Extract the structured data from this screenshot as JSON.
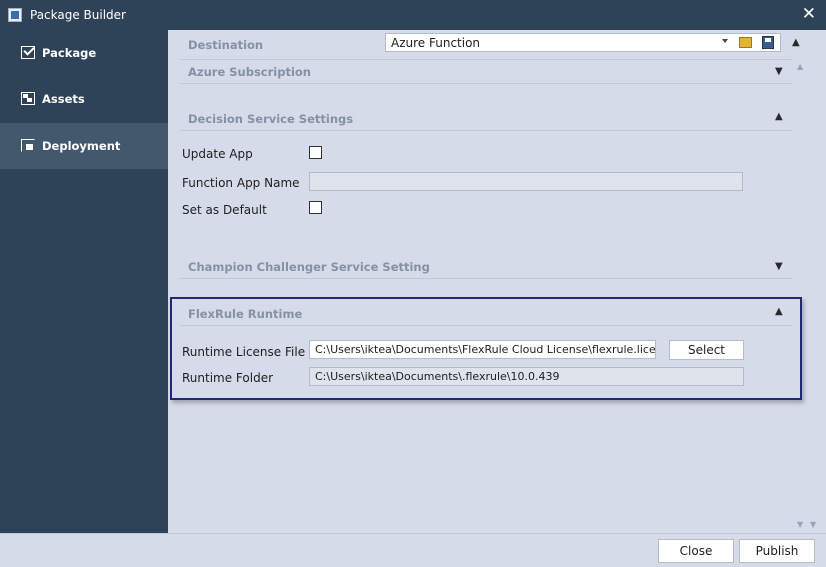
{
  "window": {
    "title": "Package Builder",
    "close_glyph": "✕"
  },
  "sidebar": {
    "items": [
      {
        "label": "Package",
        "icon": "check-icon",
        "active": false
      },
      {
        "label": "Assets",
        "icon": "assets-icon",
        "active": false
      },
      {
        "label": "Deployment",
        "icon": "deploy-icon",
        "active": true
      }
    ]
  },
  "destination": {
    "label": "Destination",
    "value": "Azure Function"
  },
  "sections": {
    "azure_subscription": {
      "title": "Azure Subscription",
      "expanded": false
    },
    "decision_service": {
      "title": "Decision Service Settings",
      "expanded": true,
      "update_app_label": "Update App",
      "update_app_checked": false,
      "function_app_name_label": "Function App Name",
      "function_app_name_value": "",
      "set_default_label": "Set as Default",
      "set_default_checked": false
    },
    "champion_challenger": {
      "title": "Champion Challenger Service Setting",
      "expanded": false
    },
    "runtime": {
      "title": "FlexRule Runtime",
      "expanded": true,
      "license_label": "Runtime License File",
      "license_value": "C:\\Users\\iktea\\Documents\\FlexRule Cloud License\\flexrule.license",
      "select_label": "Select",
      "folder_label": "Runtime Folder",
      "folder_value": "C:\\Users\\iktea\\Documents\\.flexrule\\10.0.439"
    }
  },
  "glyphs": {
    "chevron_up": "▲",
    "chevron_down": "▼"
  },
  "footer": {
    "close_label": "Close",
    "publish_label": "Publish"
  },
  "colors": {
    "sidebar_bg": "#2f4358",
    "sidebar_active": "#44586d",
    "content_bg": "#d6dbe9",
    "highlight_border": "#1f2a73"
  }
}
